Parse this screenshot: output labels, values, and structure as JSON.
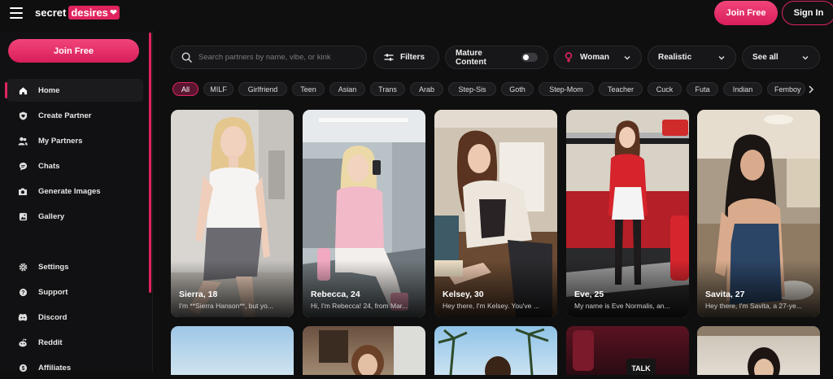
{
  "brand": {
    "word1": "secret",
    "word2": "desires"
  },
  "header": {
    "join_label": "Join Free",
    "signin_label": "Sign In"
  },
  "sidebar": {
    "join_label": "Join Free",
    "items": [
      {
        "label": "Home",
        "icon": "home-icon"
      },
      {
        "label": "Create Partner",
        "icon": "shield-heart-icon"
      },
      {
        "label": "My Partners",
        "icon": "users-icon"
      },
      {
        "label": "Chats",
        "icon": "chat-icon"
      },
      {
        "label": "Generate Images",
        "icon": "camera-icon"
      },
      {
        "label": "Gallery",
        "icon": "gallery-icon"
      },
      {
        "label": "Settings",
        "icon": "gear-icon"
      },
      {
        "label": "Support",
        "icon": "help-icon"
      },
      {
        "label": "Discord",
        "icon": "discord-icon"
      },
      {
        "label": "Reddit",
        "icon": "reddit-icon"
      },
      {
        "label": "Affiliates",
        "icon": "dollar-icon"
      }
    ]
  },
  "toolbar": {
    "search_placeholder": "Search partners by name, vibe, or kink",
    "filters_label": "Filters",
    "mature_label": "Mature Content",
    "gender_value": "Woman",
    "style_value": "Realistic",
    "sort_value": "See all"
  },
  "chips": [
    "All",
    "MILF",
    "Girlfriend",
    "Teen",
    "Asian",
    "Trans",
    "Arab",
    "Step-Sis",
    "Goth",
    "Step-Mom",
    "Teacher",
    "Cuck",
    "Futa",
    "Indian",
    "Femboy"
  ],
  "cards": [
    {
      "name": "Sierra, 18",
      "desc": "I'm **Sierra Hanson**, but yo..."
    },
    {
      "name": "Rebecca, 24",
      "desc": "Hi, I'm Rebecca! 24, from Mar..."
    },
    {
      "name": "Kelsey, 30",
      "desc": "Hey there, I'm Kelsey. You've ..."
    },
    {
      "name": "Eve, 25",
      "desc": "My name is Eve Normalis, an..."
    },
    {
      "name": "Savita, 27",
      "desc": "Hey there, I'm Savita, a 27-ye..."
    }
  ],
  "colors": {
    "accent": "#e0245e",
    "background": "#0f0f10",
    "surface": "#171719"
  }
}
